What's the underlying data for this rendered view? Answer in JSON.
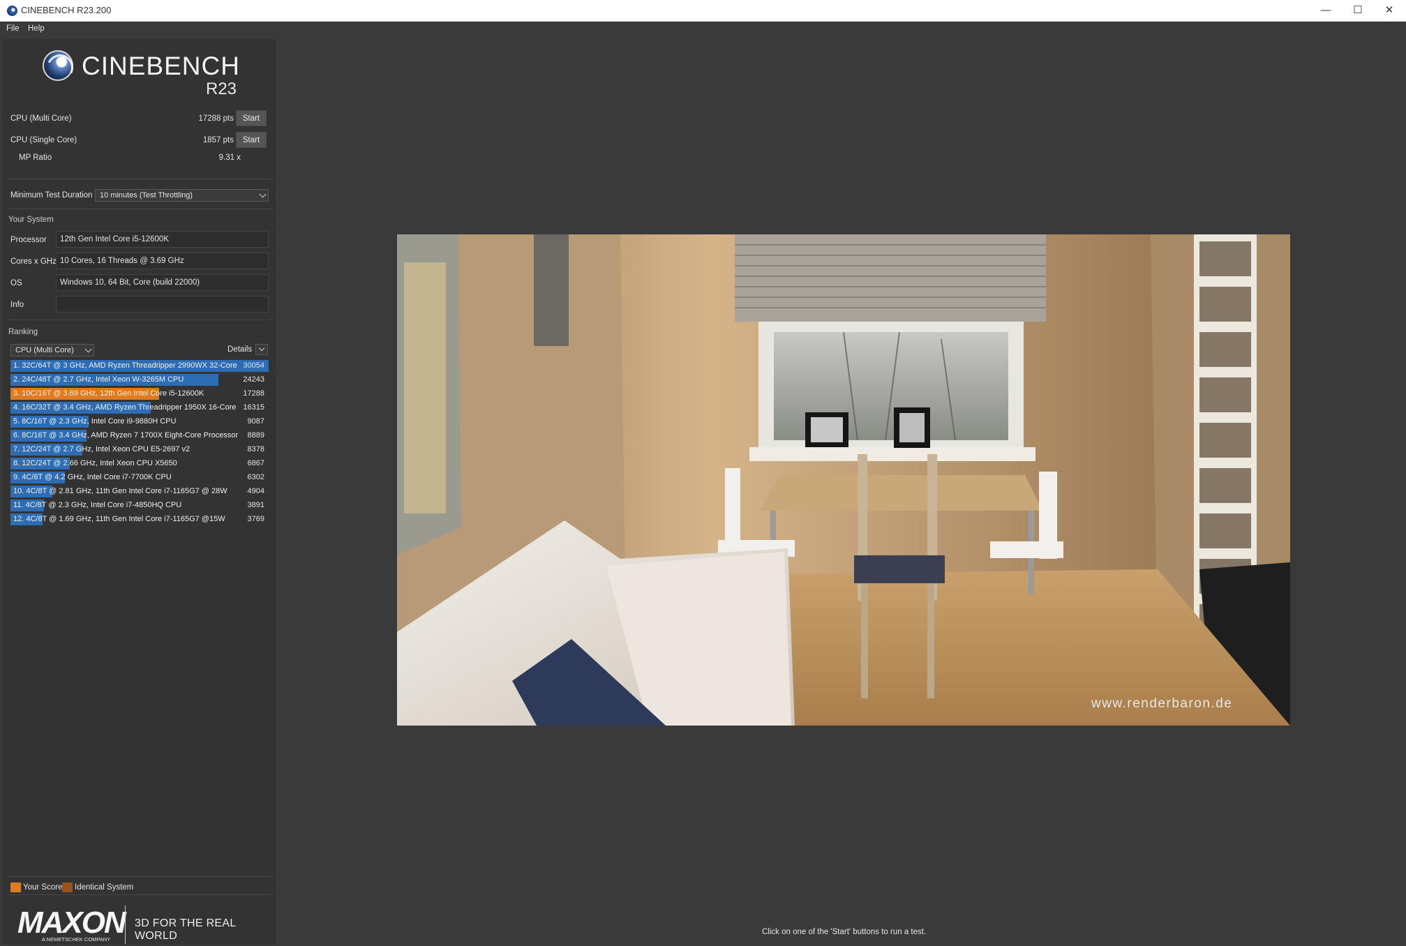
{
  "window": {
    "title": "CINEBENCH R23.200"
  },
  "menu": [
    "File",
    "Help"
  ],
  "logo": {
    "name": "CINEBENCH",
    "version": "R23"
  },
  "scores": {
    "multi": {
      "label": "CPU (Multi Core)",
      "value": "17288 pts",
      "button": "Start"
    },
    "single": {
      "label": "CPU (Single Core)",
      "value": "1857 pts",
      "button": "Start"
    },
    "mp_ratio": {
      "label": "MP Ratio",
      "value": "9.31 x"
    }
  },
  "duration": {
    "label": "Minimum Test Duration",
    "value": "10 minutes (Test Throttling)"
  },
  "system": {
    "title": "Your System",
    "processor": {
      "label": "Processor",
      "value": "12th Gen Intel Core i5-12600K"
    },
    "cores": {
      "label": "Cores x GHz",
      "value": "10 Cores, 16 Threads @ 3.69 GHz"
    },
    "os": {
      "label": "OS",
      "value": "Windows 10, 64 Bit, Core (build 22000)"
    },
    "info": {
      "label": "Info",
      "value": ""
    }
  },
  "ranking": {
    "title": "Ranking",
    "filter": "CPU (Multi Core)",
    "details": "Details",
    "max": 30054,
    "rows": [
      {
        "label": "1. 32C/64T @ 3 GHz, AMD Ryzen Threadripper 2990WX 32-Core",
        "score": 30054,
        "mine": false
      },
      {
        "label": "2. 24C/48T @ 2.7 GHz, Intel Xeon W-3265M CPU",
        "score": 24243,
        "mine": false
      },
      {
        "label": "3. 10C/16T @ 3.69 GHz, 12th Gen Intel Core i5-12600K",
        "score": 17288,
        "mine": true
      },
      {
        "label": "4. 16C/32T @ 3.4 GHz, AMD Ryzen Threadripper 1950X 16-Core",
        "score": 16315,
        "mine": false
      },
      {
        "label": "5. 8C/16T @ 2.3 GHz, Intel Core i9-9880H CPU",
        "score": 9087,
        "mine": false
      },
      {
        "label": "6. 8C/16T @ 3.4 GHz, AMD Ryzen 7 1700X Eight-Core Processor",
        "score": 8889,
        "mine": false
      },
      {
        "label": "7. 12C/24T @ 2.7 GHz, Intel Xeon CPU E5-2697 v2",
        "score": 8378,
        "mine": false
      },
      {
        "label": "8. 12C/24T @ 2.66 GHz, Intel Xeon CPU X5650",
        "score": 6867,
        "mine": false
      },
      {
        "label": "9. 4C/8T @ 4.2 GHz, Intel Core i7-7700K CPU",
        "score": 6302,
        "mine": false
      },
      {
        "label": "10. 4C/8T @ 2.81 GHz, 11th Gen Intel Core i7-1165G7 @ 28W",
        "score": 4904,
        "mine": false
      },
      {
        "label": "11. 4C/8T @ 2.3 GHz, Intel Core i7-4850HQ CPU",
        "score": 3891,
        "mine": false
      },
      {
        "label": "12. 4C/8T @ 1.69 GHz, 11th Gen Intel Core i7-1165G7 @15W",
        "score": 3769,
        "mine": false
      }
    ]
  },
  "legend": {
    "your_score": "Your Score",
    "identical": "Identical System",
    "your_color": "#e07a1f",
    "identical_color": "#9a531a",
    "bar_color": "#2e6db3"
  },
  "branding": {
    "company": "MAXON",
    "sub": "A NEMETSCHEK COMPANY",
    "tagline": "3D FOR THE REAL WORLD"
  },
  "render": {
    "watermark": "www.renderbaron.de"
  },
  "status": "Click on one of the 'Start' buttons to run a test."
}
